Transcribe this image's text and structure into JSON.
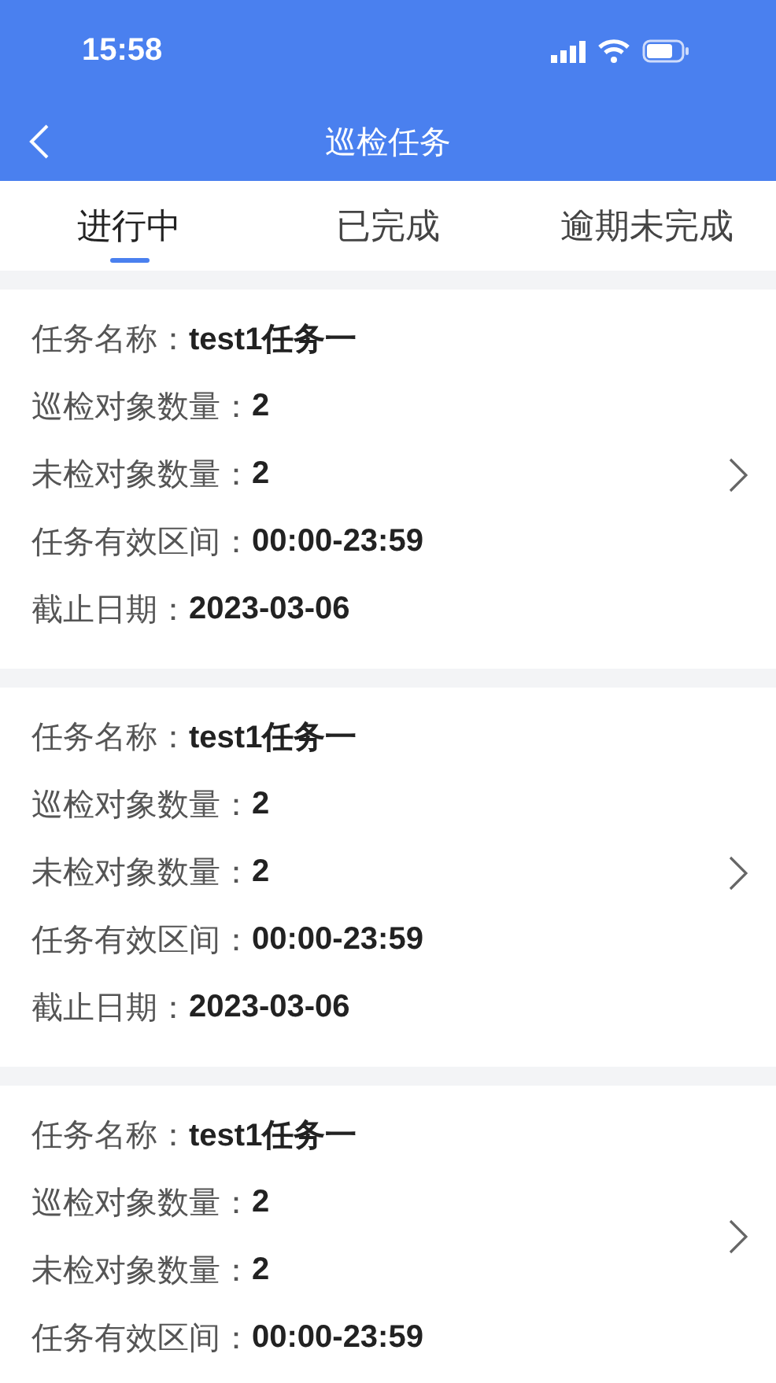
{
  "status_bar": {
    "time": "15:58"
  },
  "nav_bar": {
    "title": "巡检任务"
  },
  "tabs": [
    {
      "label": "进行中",
      "selected": true
    },
    {
      "label": "已完成",
      "selected": false
    },
    {
      "label": "逾期未完成",
      "selected": false
    }
  ],
  "tasks": [
    {
      "fields": [
        {
          "label": "任务名称：",
          "value": "test1任务一"
        },
        {
          "label": "巡检对象数量：",
          "value": "2"
        },
        {
          "label": "未检对象数量：",
          "value": "2"
        },
        {
          "label": "任务有效区间：",
          "value": "00:00-23:59"
        },
        {
          "label": "截止日期：",
          "value": "2023-03-06"
        }
      ]
    },
    {
      "fields": [
        {
          "label": "任务名称：",
          "value": "test1任务一"
        },
        {
          "label": "巡检对象数量：",
          "value": "2"
        },
        {
          "label": "未检对象数量：",
          "value": "2"
        },
        {
          "label": "任务有效区间：",
          "value": "00:00-23:59"
        },
        {
          "label": "截止日期：",
          "value": "2023-03-06"
        }
      ]
    },
    {
      "fields": [
        {
          "label": "任务名称：",
          "value": "test1任务一"
        },
        {
          "label": "巡检对象数量：",
          "value": "2"
        },
        {
          "label": "未检对象数量：",
          "value": "2"
        },
        {
          "label": "任务有效区间：",
          "value": "00:00-23:59"
        }
      ]
    }
  ]
}
